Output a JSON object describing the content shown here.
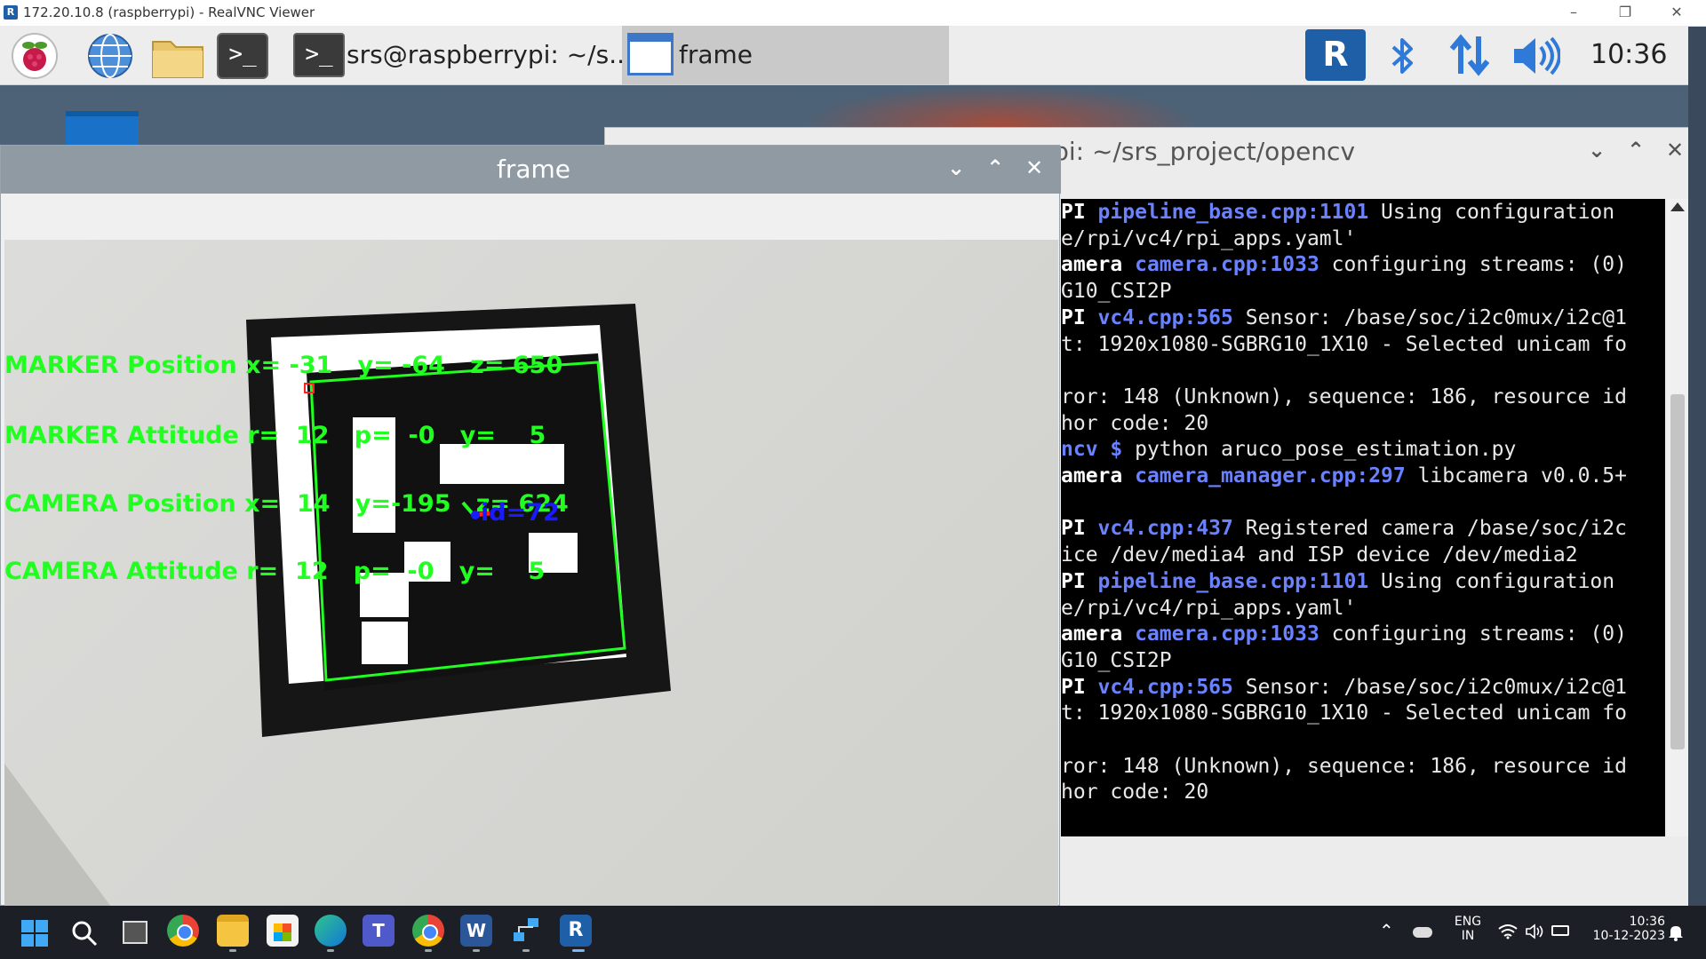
{
  "vnc_window": {
    "title": "172.20.10.8 (raspberrypi) - RealVNC Viewer",
    "minimize": "–",
    "restore": "❐",
    "close": "✕"
  },
  "pi_taskbar": {
    "terminal_glyph": ">_",
    "task_terminal_label": "srs@raspberrypi: ~/s...",
    "task_frame_label": "frame",
    "vnc_tray_glyph": "R",
    "clock": "10:36"
  },
  "terminal_window": {
    "title": "rrypi: ~/srs_project/opencv",
    "lines": [
      {
        "pre": "PI ",
        "link": "pipeline_base.cpp:1101",
        "post": " Using configuration"
      },
      {
        "pre": "",
        "link": "",
        "post": "e/rpi/vc4/rpi_apps.yaml'"
      },
      {
        "pre": "amera ",
        "link": "camera.cpp:1033",
        "post": " configuring streams: (0)"
      },
      {
        "pre": "",
        "link": "",
        "post": "G10_CSI2P"
      },
      {
        "pre": "PI ",
        "link": "vc4.cpp:565",
        "post": " Sensor: /base/soc/i2c0mux/i2c@1"
      },
      {
        "pre": "",
        "link": "",
        "post": "t: 1920x1080-SGBRG10_1X10 - Selected unicam fo"
      },
      {
        "pre": "",
        "link": "",
        "post": ""
      },
      {
        "pre": "",
        "link": "",
        "post": "ror: 148 (Unknown), sequence: 186, resource id"
      },
      {
        "pre": "",
        "link": "",
        "post": "hor code: 20"
      },
      {
        "pre": "",
        "link": "ncv $",
        "post": " python aruco_pose_estimation.py"
      },
      {
        "pre": "amera ",
        "link": "camera_manager.cpp:297",
        "post": " libcamera v0.0.5+"
      },
      {
        "pre": "",
        "link": "",
        "post": ""
      },
      {
        "pre": "PI ",
        "link": "vc4.cpp:437",
        "post": " Registered camera /base/soc/i2c"
      },
      {
        "pre": "",
        "link": "",
        "post": "ice /dev/media4 and ISP device /dev/media2"
      },
      {
        "pre": "PI ",
        "link": "pipeline_base.cpp:1101",
        "post": " Using configuration"
      },
      {
        "pre": "",
        "link": "",
        "post": "e/rpi/vc4/rpi_apps.yaml'"
      },
      {
        "pre": "amera ",
        "link": "camera.cpp:1033",
        "post": " configuring streams: (0)"
      },
      {
        "pre": "",
        "link": "",
        "post": "G10_CSI2P"
      },
      {
        "pre": "PI ",
        "link": "vc4.cpp:565",
        "post": " Sensor: /base/soc/i2c0mux/i2c@1"
      },
      {
        "pre": "",
        "link": "",
        "post": "t: 1920x1080-SGBRG10_1X10 - Selected unicam fo"
      },
      {
        "pre": "",
        "link": "",
        "post": ""
      },
      {
        "pre": "",
        "link": "",
        "post": "ror: 148 (Unknown), sequence: 186, resource id"
      },
      {
        "pre": "",
        "link": "",
        "post": "hor code: 20"
      }
    ]
  },
  "frame_window": {
    "title": "frame",
    "overlay": {
      "marker_position": "MARKER Position x= -31   y= -64   z= 650",
      "marker_attitude": "MARKER Attitude r=  12   p=  -0   y=    5",
      "camera_position": "CAMERA Position x=  14   y=-195   z= 624",
      "camera_attitude": "CAMERA Attitude r=  12   p=  -0   y=    5",
      "marker_id": "id=72"
    }
  },
  "windows_taskbar": {
    "language_top": "ENG",
    "language_bottom": "IN",
    "time": "10:36",
    "date": "10-12-2023"
  },
  "colors": {
    "overlay_text": "#21ff21",
    "marker_id_text": "#1a1aff",
    "terminal_link": "#6a82ff",
    "frame_titlebar": "#8f9aa3"
  }
}
